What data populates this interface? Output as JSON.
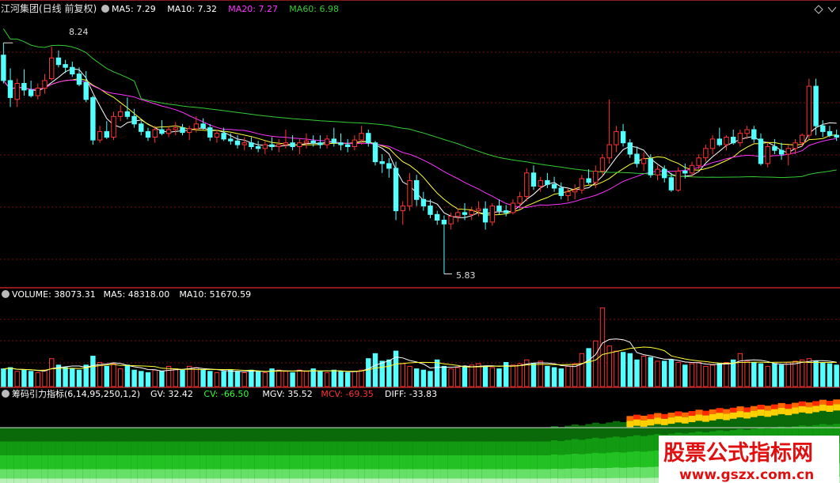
{
  "colors": {
    "bg": "#000000",
    "up": "#ff3232",
    "down": "#54ffff",
    "ma5": "#ffffff",
    "ma10": "#ffff33",
    "ma20": "#ff33ff",
    "ma60": "#33cc33",
    "grid": "#7a1010",
    "text": "#c8c8c8"
  },
  "price_panel": {
    "stock_name": "江河集团(日线 前复权)",
    "ma_labels": [
      {
        "text": "MA5: 7.29",
        "color": "#ffffff"
      },
      {
        "text": "MA10: 7.32",
        "color": "#ffffff"
      },
      {
        "text": "MA20: 7.27",
        "color": "#ff33ff"
      },
      {
        "text": "MA60: 6.98",
        "color": "#33cc33"
      }
    ],
    "high_label": "8.24",
    "low_label": "5.83"
  },
  "volume_panel": {
    "labels": [
      {
        "text": "VOLUME: 38073.31",
        "color": "#ffffff"
      },
      {
        "text": "MA5: 48318.00",
        "color": "#ffffff"
      },
      {
        "text": "MA10: 51670.59",
        "color": "#ffffff"
      }
    ]
  },
  "indicator_panel": {
    "labels": [
      {
        "text": "筹码引力指标(6,14,95,250,1,2)",
        "color": "#ffffff"
      },
      {
        "text": "GV: 32.42",
        "color": "#ffffff"
      },
      {
        "text": "CV: -66.50",
        "color": "#33ff33"
      },
      {
        "text": "MGV: 35.52",
        "color": "#ffffff"
      },
      {
        "text": "MCV: -69.35",
        "color": "#ff3232"
      },
      {
        "text": "DIFF: -33.83",
        "color": "#ffffff"
      }
    ]
  },
  "watermark": {
    "cn": "股票公式指标网",
    "url": "www.gszx.com.cn"
  },
  "chart_data": {
    "type": "candlestick",
    "ylim": [
      5.7,
      8.55
    ],
    "dates_count": 122,
    "ohlc": [
      [
        8.15,
        8.28,
        7.85,
        7.88
      ],
      [
        7.88,
        8.01,
        7.6,
        7.7
      ],
      [
        7.68,
        7.9,
        7.6,
        7.85
      ],
      [
        7.85,
        8.0,
        7.72,
        7.78
      ],
      [
        7.78,
        7.88,
        7.7,
        7.72
      ],
      [
        7.72,
        7.85,
        7.68,
        7.8
      ],
      [
        7.8,
        7.95,
        7.74,
        7.88
      ],
      [
        7.9,
        8.24,
        7.88,
        8.12
      ],
      [
        8.12,
        8.2,
        8.02,
        8.05
      ],
      [
        8.05,
        8.1,
        7.96,
        8.02
      ],
      [
        8.02,
        8.08,
        7.92,
        7.95
      ],
      [
        7.95,
        8.02,
        7.82,
        7.84
      ],
      [
        7.86,
        7.98,
        7.65,
        7.68
      ],
      [
        7.7,
        7.72,
        7.2,
        7.25
      ],
      [
        7.25,
        7.4,
        7.22,
        7.34
      ],
      [
        7.34,
        7.45,
        7.26,
        7.28
      ],
      [
        7.28,
        7.55,
        7.25,
        7.5
      ],
      [
        7.5,
        7.62,
        7.45,
        7.55
      ],
      [
        7.55,
        7.7,
        7.47,
        7.5
      ],
      [
        7.5,
        7.58,
        7.38,
        7.42
      ],
      [
        7.42,
        7.45,
        7.3,
        7.34
      ],
      [
        7.34,
        7.38,
        7.24,
        7.28
      ],
      [
        7.28,
        7.4,
        7.22,
        7.36
      ],
      [
        7.36,
        7.46,
        7.3,
        7.32
      ],
      [
        7.32,
        7.4,
        7.28,
        7.36
      ],
      [
        7.36,
        7.44,
        7.3,
        7.38
      ],
      [
        7.38,
        7.42,
        7.3,
        7.33
      ],
      [
        7.33,
        7.4,
        7.25,
        7.37
      ],
      [
        7.37,
        7.5,
        7.33,
        7.42
      ],
      [
        7.42,
        7.48,
        7.36,
        7.38
      ],
      [
        7.38,
        7.42,
        7.24,
        7.28
      ],
      [
        7.28,
        7.36,
        7.22,
        7.32
      ],
      [
        7.32,
        7.38,
        7.24,
        7.26
      ],
      [
        7.26,
        7.32,
        7.2,
        7.24
      ],
      [
        7.24,
        7.3,
        7.16,
        7.2
      ],
      [
        7.2,
        7.28,
        7.14,
        7.22
      ],
      [
        7.22,
        7.28,
        7.15,
        7.18
      ],
      [
        7.18,
        7.24,
        7.12,
        7.16
      ],
      [
        7.16,
        7.24,
        7.1,
        7.2
      ],
      [
        7.2,
        7.28,
        7.14,
        7.18
      ],
      [
        7.18,
        7.26,
        7.12,
        7.2
      ],
      [
        7.2,
        7.36,
        7.16,
        7.22
      ],
      [
        7.22,
        7.3,
        7.14,
        7.18
      ],
      [
        7.18,
        7.26,
        7.1,
        7.22
      ],
      [
        7.22,
        7.32,
        7.16,
        7.24
      ],
      [
        7.24,
        7.3,
        7.18,
        7.22
      ],
      [
        7.22,
        7.3,
        7.16,
        7.2
      ],
      [
        7.2,
        7.3,
        7.16,
        7.26
      ],
      [
        7.26,
        7.38,
        7.18,
        7.22
      ],
      [
        7.22,
        7.32,
        7.14,
        7.2
      ],
      [
        7.2,
        7.26,
        7.12,
        7.18
      ],
      [
        7.18,
        7.3,
        7.14,
        7.25
      ],
      [
        7.25,
        7.4,
        7.2,
        7.32
      ],
      [
        7.32,
        7.36,
        7.18,
        7.22
      ],
      [
        7.22,
        7.24,
        6.98,
        7.02
      ],
      [
        7.02,
        7.1,
        6.9,
        7.0
      ],
      [
        7.0,
        7.06,
        6.85,
        6.95
      ],
      [
        6.95,
        7.02,
        6.4,
        6.5
      ],
      [
        6.5,
        6.6,
        6.35,
        6.55
      ],
      [
        6.55,
        6.9,
        6.5,
        6.82
      ],
      [
        6.82,
        6.88,
        6.55,
        6.62
      ],
      [
        6.62,
        6.7,
        6.5,
        6.55
      ],
      [
        6.55,
        6.62,
        6.42,
        6.46
      ],
      [
        6.46,
        6.5,
        6.35,
        6.4
      ],
      [
        6.4,
        6.45,
        5.83,
        6.36
      ],
      [
        6.36,
        6.48,
        6.3,
        6.44
      ],
      [
        6.44,
        6.52,
        6.38,
        6.48
      ],
      [
        6.48,
        6.58,
        6.4,
        6.46
      ],
      [
        6.46,
        6.54,
        6.4,
        6.5
      ],
      [
        6.5,
        6.6,
        6.44,
        6.52
      ],
      [
        6.52,
        6.6,
        6.3,
        6.38
      ],
      [
        6.38,
        6.58,
        6.34,
        6.55
      ],
      [
        6.55,
        6.62,
        6.46,
        6.5
      ],
      [
        6.5,
        6.56,
        6.44,
        6.48
      ],
      [
        6.48,
        6.62,
        6.46,
        6.58
      ],
      [
        6.58,
        6.7,
        6.52,
        6.65
      ],
      [
        6.65,
        6.95,
        6.6,
        6.9
      ],
      [
        6.9,
        6.98,
        6.72,
        6.76
      ],
      [
        6.76,
        6.86,
        6.7,
        6.82
      ],
      [
        6.82,
        6.9,
        6.74,
        6.78
      ],
      [
        6.78,
        6.86,
        6.7,
        6.74
      ],
      [
        6.74,
        6.8,
        6.62,
        6.66
      ],
      [
        6.66,
        6.74,
        6.6,
        6.7
      ],
      [
        6.7,
        6.78,
        6.62,
        6.72
      ],
      [
        6.72,
        6.88,
        6.68,
        6.84
      ],
      [
        6.84,
        6.94,
        6.78,
        6.8
      ],
      [
        6.8,
        6.98,
        6.74,
        6.92
      ],
      [
        6.92,
        7.1,
        6.88,
        7.06
      ],
      [
        7.06,
        7.68,
        7.0,
        7.2
      ],
      [
        7.2,
        7.4,
        7.12,
        7.34
      ],
      [
        7.34,
        7.42,
        7.18,
        7.22
      ],
      [
        7.22,
        7.26,
        7.06,
        7.1
      ],
      [
        7.1,
        7.18,
        6.96,
        7.0
      ],
      [
        7.0,
        7.12,
        6.92,
        7.05
      ],
      [
        7.05,
        7.1,
        6.85,
        6.88
      ],
      [
        6.88,
        6.98,
        6.82,
        6.94
      ],
      [
        6.94,
        6.98,
        6.8,
        6.85
      ],
      [
        6.85,
        6.9,
        6.7,
        6.72
      ],
      [
        6.72,
        6.96,
        6.7,
        6.92
      ],
      [
        6.92,
        7.0,
        6.84,
        6.9
      ],
      [
        6.9,
        7.02,
        6.86,
        6.98
      ],
      [
        6.98,
        7.1,
        6.94,
        7.06
      ],
      [
        7.06,
        7.2,
        7.02,
        7.16
      ],
      [
        7.16,
        7.3,
        7.1,
        7.26
      ],
      [
        7.26,
        7.38,
        7.18,
        7.2
      ],
      [
        7.2,
        7.3,
        7.14,
        7.28
      ],
      [
        7.28,
        7.36,
        7.2,
        7.22
      ],
      [
        7.22,
        7.36,
        7.18,
        7.32
      ],
      [
        7.32,
        7.4,
        7.26,
        7.36
      ],
      [
        7.36,
        7.4,
        7.22,
        7.26
      ],
      [
        7.26,
        7.32,
        6.98,
        7.0
      ],
      [
        7.0,
        7.22,
        6.96,
        7.18
      ],
      [
        7.18,
        7.26,
        7.1,
        7.14
      ],
      [
        7.14,
        7.22,
        7.04,
        7.1
      ],
      [
        7.1,
        7.2,
        6.98,
        7.16
      ],
      [
        7.16,
        7.26,
        7.1,
        7.22
      ],
      [
        7.22,
        7.32,
        7.18,
        7.3
      ],
      [
        7.3,
        7.9,
        7.26,
        7.82
      ],
      [
        7.82,
        7.9,
        7.3,
        7.4
      ],
      [
        7.4,
        7.46,
        7.28,
        7.34
      ],
      [
        7.34,
        7.4,
        7.28,
        7.3
      ],
      [
        7.3,
        7.36,
        7.24,
        7.28
      ]
    ],
    "volume": [
      14000,
      15000,
      12000,
      13000,
      12000,
      11000,
      13000,
      22000,
      17000,
      15000,
      14000,
      13000,
      17000,
      24000,
      19000,
      16000,
      18000,
      14000,
      17000,
      13000,
      12000,
      11000,
      13000,
      12000,
      16000,
      14000,
      13000,
      16000,
      15000,
      13000,
      12000,
      11000,
      12000,
      13000,
      12000,
      11000,
      13000,
      12000,
      11000,
      14000,
      13000,
      12000,
      11000,
      13000,
      12000,
      14000,
      12000,
      11000,
      13000,
      12000,
      11000,
      12000,
      13000,
      22000,
      26000,
      20000,
      21000,
      28000,
      18000,
      16000,
      14000,
      13000,
      12000,
      21000,
      16000,
      14000,
      15000,
      16000,
      17000,
      18000,
      16000,
      15000,
      14000,
      19000,
      17000,
      18000,
      21000,
      18000,
      20000,
      16000,
      15000,
      14000,
      16000,
      18000,
      26000,
      30000,
      36000,
      62000,
      32000,
      28000,
      27000,
      26000,
      21000,
      24000,
      23000,
      20000,
      20000,
      21000,
      19000,
      17000,
      18000,
      19000,
      16000,
      17000,
      18000,
      19000,
      21000,
      26000,
      20000,
      19000,
      18000,
      16000,
      18000,
      17000,
      19000,
      20000,
      21000,
      22000,
      20000,
      19000,
      18000,
      17000
    ],
    "volume_ylim": [
      0,
      68000
    ],
    "ma_periods": [
      5,
      10,
      20,
      60
    ],
    "volume_ma_periods": [
      5,
      10
    ]
  }
}
